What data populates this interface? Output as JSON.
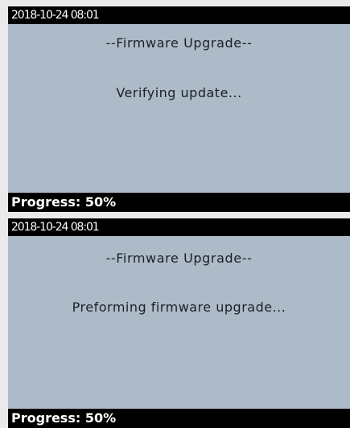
{
  "screens": [
    {
      "timestamp": "2018-10-24 08:01",
      "title": "--Firmware Upgrade--",
      "message": "Verifying update...",
      "progress_label": "Progress: 50%",
      "progress_percent": 50
    },
    {
      "timestamp": "2018-10-24 08:01",
      "title": "--Firmware Upgrade--",
      "message": "Preforming firmware upgrade...",
      "progress_label": "Progress: 50%",
      "progress_percent": 50
    }
  ],
  "colors": {
    "screen_background": "#adbac8",
    "bar_background": "#000000",
    "bar_text": "#ffffff",
    "body_text": "#1b2026"
  }
}
